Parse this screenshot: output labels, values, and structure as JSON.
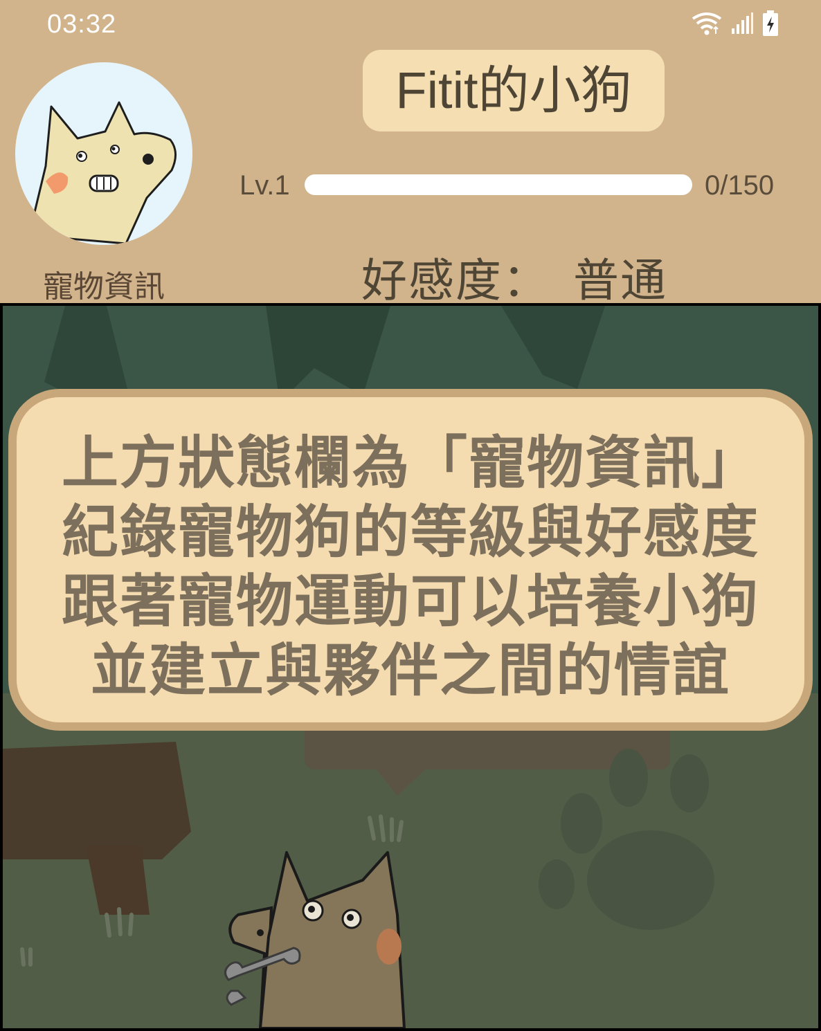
{
  "status_bar": {
    "time": "03:32",
    "icons": [
      "wifi-icon",
      "signal-icon",
      "battery-charging-icon"
    ]
  },
  "pet_info": {
    "caption": "寵物資訊",
    "name": "Fitit的小狗",
    "level_label": "Lv.1",
    "exp_count": "0/150",
    "exp_progress": 0,
    "affection_label": "好感度：",
    "affection_value": "普通"
  },
  "tutorial": {
    "lines": [
      "上方狀態欄為「寵物資訊」",
      "紀錄寵物狗的等級與好感度",
      "跟著寵物運動可以培養小狗",
      "並建立與夥伴之間的情誼"
    ]
  },
  "colors": {
    "header_bg": "#d2b48c",
    "pill_bg": "#f5dfb2",
    "bubble_bg": "#f5dcb0",
    "bubble_border": "#c8a77a",
    "scene_bg": "#525d48",
    "text_dark": "#4e4535"
  }
}
